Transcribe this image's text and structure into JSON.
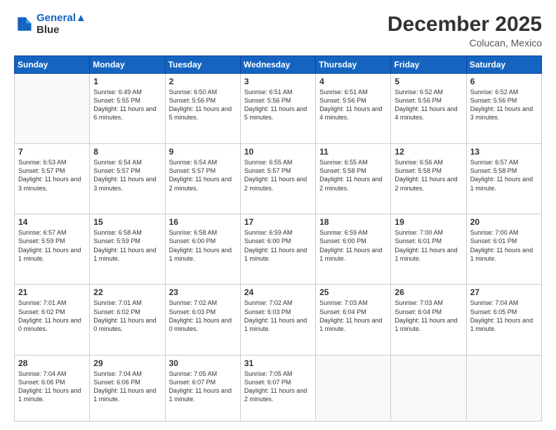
{
  "header": {
    "logo": {
      "line1": "General",
      "line2": "Blue"
    },
    "title": "December 2025",
    "subtitle": "Colucan, Mexico"
  },
  "calendar": {
    "days_of_week": [
      "Sunday",
      "Monday",
      "Tuesday",
      "Wednesday",
      "Thursday",
      "Friday",
      "Saturday"
    ],
    "weeks": [
      [
        {
          "day": "",
          "info": ""
        },
        {
          "day": "1",
          "info": "Sunrise: 6:49 AM\nSunset: 5:55 PM\nDaylight: 11 hours\nand 6 minutes."
        },
        {
          "day": "2",
          "info": "Sunrise: 6:50 AM\nSunset: 5:56 PM\nDaylight: 11 hours\nand 5 minutes."
        },
        {
          "day": "3",
          "info": "Sunrise: 6:51 AM\nSunset: 5:56 PM\nDaylight: 11 hours\nand 5 minutes."
        },
        {
          "day": "4",
          "info": "Sunrise: 6:51 AM\nSunset: 5:56 PM\nDaylight: 11 hours\nand 4 minutes."
        },
        {
          "day": "5",
          "info": "Sunrise: 6:52 AM\nSunset: 5:56 PM\nDaylight: 11 hours\nand 4 minutes."
        },
        {
          "day": "6",
          "info": "Sunrise: 6:52 AM\nSunset: 5:56 PM\nDaylight: 11 hours\nand 3 minutes."
        }
      ],
      [
        {
          "day": "7",
          "info": "Sunrise: 6:53 AM\nSunset: 5:57 PM\nDaylight: 11 hours\nand 3 minutes."
        },
        {
          "day": "8",
          "info": "Sunrise: 6:54 AM\nSunset: 5:57 PM\nDaylight: 11 hours\nand 3 minutes."
        },
        {
          "day": "9",
          "info": "Sunrise: 6:54 AM\nSunset: 5:57 PM\nDaylight: 11 hours\nand 2 minutes."
        },
        {
          "day": "10",
          "info": "Sunrise: 6:55 AM\nSunset: 5:57 PM\nDaylight: 11 hours\nand 2 minutes."
        },
        {
          "day": "11",
          "info": "Sunrise: 6:55 AM\nSunset: 5:58 PM\nDaylight: 11 hours\nand 2 minutes."
        },
        {
          "day": "12",
          "info": "Sunrise: 6:56 AM\nSunset: 5:58 PM\nDaylight: 11 hours\nand 2 minutes."
        },
        {
          "day": "13",
          "info": "Sunrise: 6:57 AM\nSunset: 5:58 PM\nDaylight: 11 hours\nand 1 minute."
        }
      ],
      [
        {
          "day": "14",
          "info": "Sunrise: 6:57 AM\nSunset: 5:59 PM\nDaylight: 11 hours\nand 1 minute."
        },
        {
          "day": "15",
          "info": "Sunrise: 6:58 AM\nSunset: 5:59 PM\nDaylight: 11 hours\nand 1 minute."
        },
        {
          "day": "16",
          "info": "Sunrise: 6:58 AM\nSunset: 6:00 PM\nDaylight: 11 hours\nand 1 minute."
        },
        {
          "day": "17",
          "info": "Sunrise: 6:59 AM\nSunset: 6:00 PM\nDaylight: 11 hours\nand 1 minute."
        },
        {
          "day": "18",
          "info": "Sunrise: 6:59 AM\nSunset: 6:00 PM\nDaylight: 11 hours\nand 1 minute."
        },
        {
          "day": "19",
          "info": "Sunrise: 7:00 AM\nSunset: 6:01 PM\nDaylight: 11 hours\nand 1 minute."
        },
        {
          "day": "20",
          "info": "Sunrise: 7:00 AM\nSunset: 6:01 PM\nDaylight: 11 hours\nand 1 minute."
        }
      ],
      [
        {
          "day": "21",
          "info": "Sunrise: 7:01 AM\nSunset: 6:02 PM\nDaylight: 11 hours\nand 0 minutes."
        },
        {
          "day": "22",
          "info": "Sunrise: 7:01 AM\nSunset: 6:02 PM\nDaylight: 11 hours\nand 0 minutes."
        },
        {
          "day": "23",
          "info": "Sunrise: 7:02 AM\nSunset: 6:03 PM\nDaylight: 11 hours\nand 0 minutes."
        },
        {
          "day": "24",
          "info": "Sunrise: 7:02 AM\nSunset: 6:03 PM\nDaylight: 11 hours\nand 1 minute."
        },
        {
          "day": "25",
          "info": "Sunrise: 7:03 AM\nSunset: 6:04 PM\nDaylight: 11 hours\nand 1 minute."
        },
        {
          "day": "26",
          "info": "Sunrise: 7:03 AM\nSunset: 6:04 PM\nDaylight: 11 hours\nand 1 minute."
        },
        {
          "day": "27",
          "info": "Sunrise: 7:04 AM\nSunset: 6:05 PM\nDaylight: 11 hours\nand 1 minute."
        }
      ],
      [
        {
          "day": "28",
          "info": "Sunrise: 7:04 AM\nSunset: 6:06 PM\nDaylight: 11 hours\nand 1 minute."
        },
        {
          "day": "29",
          "info": "Sunrise: 7:04 AM\nSunset: 6:06 PM\nDaylight: 11 hours\nand 1 minute."
        },
        {
          "day": "30",
          "info": "Sunrise: 7:05 AM\nSunset: 6:07 PM\nDaylight: 11 hours\nand 1 minute."
        },
        {
          "day": "31",
          "info": "Sunrise: 7:05 AM\nSunset: 6:07 PM\nDaylight: 11 hours\nand 2 minutes."
        },
        {
          "day": "",
          "info": ""
        },
        {
          "day": "",
          "info": ""
        },
        {
          "day": "",
          "info": ""
        }
      ]
    ]
  }
}
